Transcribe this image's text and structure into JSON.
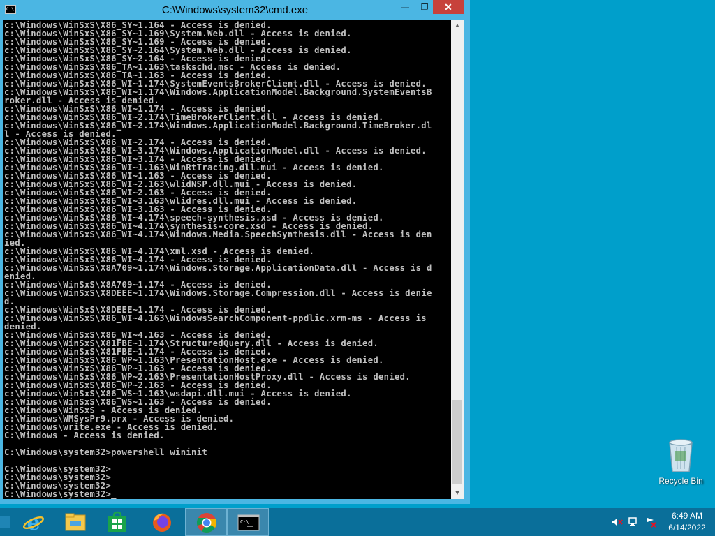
{
  "window": {
    "title": "C:\\Windows\\system32\\cmd.exe",
    "icon_text": "C:\\",
    "minimize": "—",
    "maximize": "❐",
    "close": "✕"
  },
  "console": {
    "lines": [
      "c:\\Windows\\WinSxS\\X86_SY~1.164 - Access is denied.",
      "c:\\Windows\\WinSxS\\X86_SY~1.169\\System.Web.dll - Access is denied.",
      "c:\\Windows\\WinSxS\\X86_SY~1.169 - Access is denied.",
      "c:\\Windows\\WinSxS\\X86_SY~2.164\\System.Web.dll - Access is denied.",
      "c:\\Windows\\WinSxS\\X86_SY~2.164 - Access is denied.",
      "c:\\Windows\\WinSxS\\X86_TA~1.163\\taskschd.msc - Access is denied.",
      "c:\\Windows\\WinSxS\\X86_TA~1.163 - Access is denied.",
      "c:\\Windows\\WinSxS\\X86_WI~1.174\\SystemEventsBrokerClient.dll - Access is denied.",
      "c:\\Windows\\WinSxS\\X86_WI~1.174\\Windows.ApplicationModel.Background.SystemEventsB",
      "roker.dll - Access is denied.",
      "c:\\Windows\\WinSxS\\X86_WI~1.174 - Access is denied.",
      "c:\\Windows\\WinSxS\\X86_WI~2.174\\TimeBrokerClient.dll - Access is denied.",
      "c:\\Windows\\WinSxS\\X86_WI~2.174\\Windows.ApplicationModel.Background.TimeBroker.dl",
      "l - Access is denied.",
      "c:\\Windows\\WinSxS\\X86_WI~2.174 - Access is denied.",
      "c:\\Windows\\WinSxS\\X86_WI~3.174\\Windows.ApplicationModel.dll - Access is denied.",
      "c:\\Windows\\WinSxS\\X86_WI~3.174 - Access is denied.",
      "c:\\Windows\\WinSxS\\X86_WI~1.163\\WinRtTracing.dll.mui - Access is denied.",
      "c:\\Windows\\WinSxS\\X86_WI~1.163 - Access is denied.",
      "c:\\Windows\\WinSxS\\X86_WI~2.163\\wlidNSP.dll.mui - Access is denied.",
      "c:\\Windows\\WinSxS\\X86_WI~2.163 - Access is denied.",
      "c:\\Windows\\WinSxS\\X86_WI~3.163\\wlidres.dll.mui - Access is denied.",
      "c:\\Windows\\WinSxS\\X86_WI~3.163 - Access is denied.",
      "c:\\Windows\\WinSxS\\X86_WI~4.174\\speech-synthesis.xsd - Access is denied.",
      "c:\\Windows\\WinSxS\\X86_WI~4.174\\synthesis-core.xsd - Access is denied.",
      "c:\\Windows\\WinSxS\\X86_WI~4.174\\Windows.Media.SpeechSynthesis.dll - Access is den",
      "ied.",
      "c:\\Windows\\WinSxS\\X86_WI~4.174\\xml.xsd - Access is denied.",
      "c:\\Windows\\WinSxS\\X86_WI~4.174 - Access is denied.",
      "c:\\Windows\\WinSxS\\X8A709~1.174\\Windows.Storage.ApplicationData.dll - Access is d",
      "enied.",
      "c:\\Windows\\WinSxS\\X8A709~1.174 - Access is denied.",
      "c:\\Windows\\WinSxS\\X8DEEE~1.174\\Windows.Storage.Compression.dll - Access is denie",
      "d.",
      "c:\\Windows\\WinSxS\\X8DEEE~1.174 - Access is denied.",
      "c:\\Windows\\WinSxS\\X86_WI~4.163\\WindowsSearchComponent-ppdlic.xrm-ms - Access is",
      "denied.",
      "c:\\Windows\\WinSxS\\X86_WI~4.163 - Access is denied.",
      "c:\\Windows\\WinSxS\\X81FBE~1.174\\StructuredQuery.dll - Access is denied.",
      "c:\\Windows\\WinSxS\\X81FBE~1.174 - Access is denied.",
      "c:\\Windows\\WinSxS\\X86_WP~1.163\\PresentationHost.exe - Access is denied.",
      "c:\\Windows\\WinSxS\\X86_WP~1.163 - Access is denied.",
      "c:\\Windows\\WinSxS\\X86_WP~2.163\\PresentationHostProxy.dll - Access is denied.",
      "c:\\Windows\\WinSxS\\X86_WP~2.163 - Access is denied.",
      "c:\\Windows\\WinSxS\\X86_WS~1.163\\wsdapi.dll.mui - Access is denied.",
      "c:\\Windows\\WinSxS\\X86_WS~1.163 - Access is denied.",
      "c:\\Windows\\WinSxS - Access is denied.",
      "c:\\Windows\\WMSysPr9.prx - Access is denied.",
      "c:\\Windows\\write.exe - Access is denied.",
      "C:\\Windows - Access is denied.",
      "",
      "C:\\Windows\\system32>powershell wininit",
      "",
      "C:\\Windows\\system32>",
      "C:\\Windows\\system32>",
      "C:\\Windows\\system32>",
      "C:\\Windows\\system32>_"
    ]
  },
  "scrollbar": {
    "up": "▲",
    "down": "▼"
  },
  "desktop": {
    "recycle_bin_label": "Recycle Bin"
  },
  "taskbar": {
    "pinned": [
      "internet-explorer",
      "file-explorer",
      "store",
      "firefox",
      "chrome",
      "command-prompt"
    ],
    "clock_time": "6:49 AM",
    "clock_date": "6/14/2022",
    "tray_icons": [
      "speaker-muted-icon",
      "network-icon",
      "action-center-icon"
    ]
  },
  "colors": {
    "desktop": "#009fcb",
    "window_frame": "#4bb6e3",
    "close_button": "#c7413b",
    "console_bg": "#000000",
    "console_text": "#c0c0c0",
    "taskbar": "#0a6f9a"
  }
}
